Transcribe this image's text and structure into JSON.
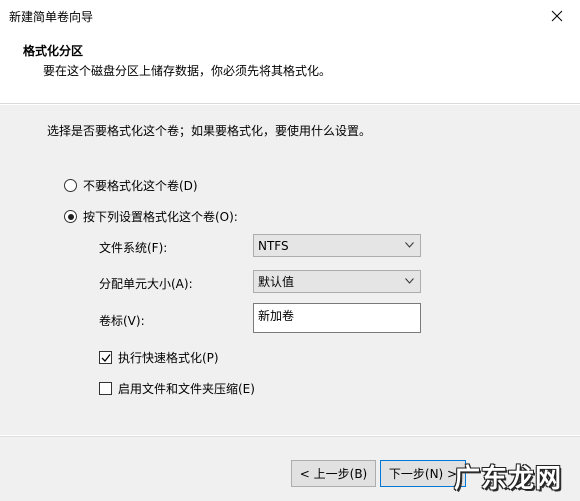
{
  "window": {
    "title": "新建简单卷向导"
  },
  "header": {
    "title": "格式化分区",
    "subtitle": "要在这个磁盘分区上储存数据，你必须先将其格式化。"
  },
  "content": {
    "instruction": "选择是否要格式化这个卷；如果要格式化，要使用什么设置。",
    "radio_no_format": "不要格式化这个卷(D)",
    "radio_format": "按下列设置格式化这个卷(O):",
    "filesystem_label": "文件系统(F):",
    "filesystem_value": "NTFS",
    "alloc_label": "分配单元大小(A):",
    "alloc_value": "默认值",
    "volume_label": "卷标(V):",
    "volume_value": "新加卷",
    "quick_format": "执行快速格式化(P)",
    "compression": "启用文件和文件夹压缩(E)"
  },
  "footer": {
    "back": "< 上一步(B)",
    "next": "下一步(N) >"
  },
  "watermark": {
    "text": "广东龙网"
  },
  "icons": {
    "close": "close-icon",
    "dropdown": "chevron-down-icon",
    "check": "checkmark-icon"
  }
}
